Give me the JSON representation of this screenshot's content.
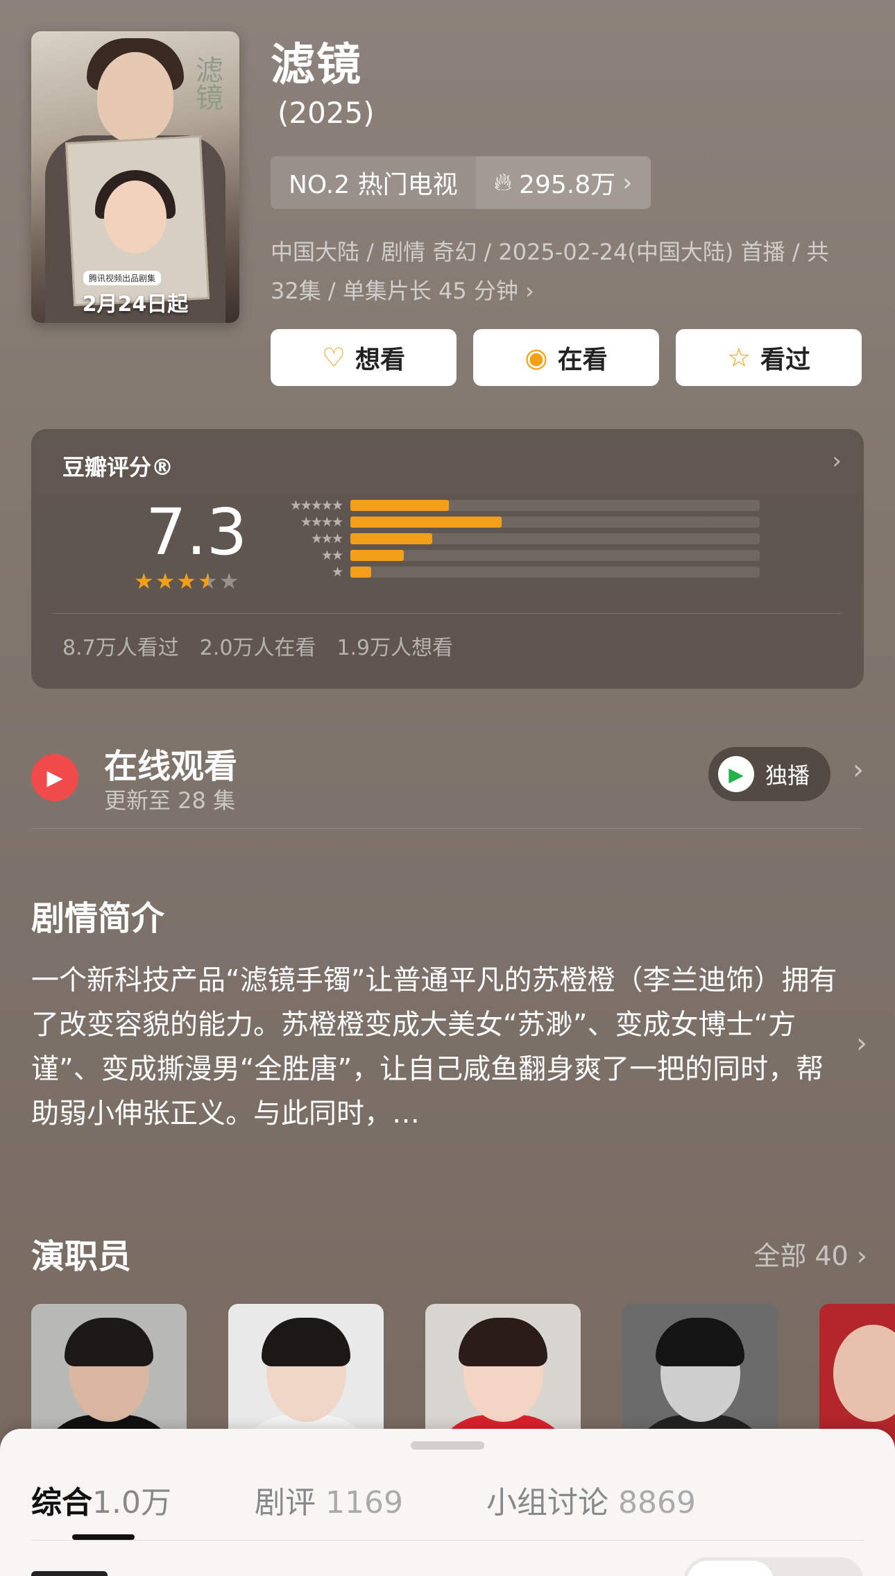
{
  "header": {
    "title": "滤镜",
    "year": "(2025)",
    "rank_label": "NO.2 热门电视",
    "heat_value": "295.8万",
    "meta_line1": "中国大陆 / 剧情 奇幻 / 2025-02-24(中国大陆) 首播 / 共",
    "meta_line2": "32集 / 单集片长 45 分钟",
    "poster": {
      "vertical_title": "滤镜",
      "badge": "腾讯视频出品剧集",
      "date": "2月24日起"
    },
    "actions": [
      {
        "label": "想看",
        "icon": "heart-plus-icon"
      },
      {
        "label": "在看",
        "icon": "target-icon"
      },
      {
        "label": "看过",
        "icon": "star-outline-icon"
      }
    ]
  },
  "rating": {
    "label": "豆瓣评分®",
    "score": "7.3",
    "stars_full": 3,
    "stars_half": 1,
    "distribution": [
      {
        "stars": "★★★★★",
        "fraction": 0.24
      },
      {
        "stars": "★★★★",
        "fraction": 0.37
      },
      {
        "stars": "★★★",
        "fraction": 0.2
      },
      {
        "stars": "★★",
        "fraction": 0.13
      },
      {
        "stars": "★",
        "fraction": 0.05
      }
    ],
    "stats": [
      "8.7万人看过",
      "2.0万人在看",
      "1.9万人想看"
    ]
  },
  "watch": {
    "title": "在线观看",
    "subtitle": "更新至 28 集",
    "platform_label": "独播"
  },
  "synopsis": {
    "title": "剧情简介",
    "text": "一个新科技产品“滤镜手镯”让普通平凡的苏橙橙（李兰迪饰）拥有了改变容貌的能力。苏橙橙变成大美女“苏渺”、变成女博士“方谨”、变成撕漫男“全胜唐”，让自己咸鱼翻身爽了一把的同时，帮助弱小伸张正义。与此同时，…"
  },
  "cast": {
    "title": "演职员",
    "more": "全部 40"
  },
  "sheet": {
    "tabs": [
      {
        "label": "综合",
        "count": "1.0万"
      },
      {
        "label": "剧评",
        "count": "1169"
      },
      {
        "label": "小组讨论",
        "count": "8869"
      }
    ]
  },
  "colors": {
    "accent": "#f2a01a",
    "play_red": "#f04a4a",
    "background": "#7a6f68"
  }
}
